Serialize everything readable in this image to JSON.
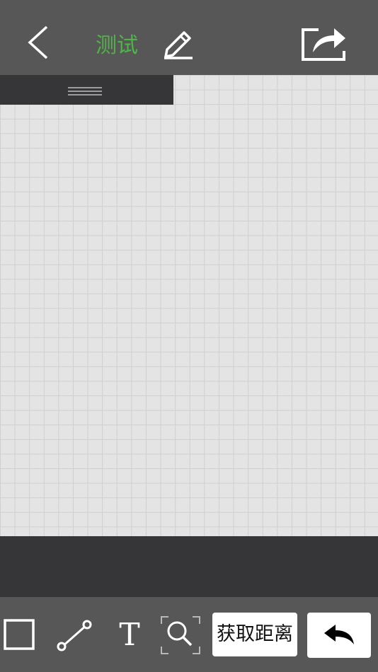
{
  "header": {
    "title": "测试",
    "back_icon": "chevron-left-icon",
    "edit_icon": "pencil-icon",
    "share_icon": "share-export-icon",
    "title_color": "#4fb548"
  },
  "panel": {
    "handle_icon": "drag-handle-icon"
  },
  "toolbar": {
    "rect_icon": "rectangle-icon",
    "line_icon": "line-segment-icon",
    "text_tool_label": "T",
    "zoom_icon": "zoom-select-icon",
    "measure_label": "获取距离",
    "undo_icon": "undo-arrow-icon"
  }
}
